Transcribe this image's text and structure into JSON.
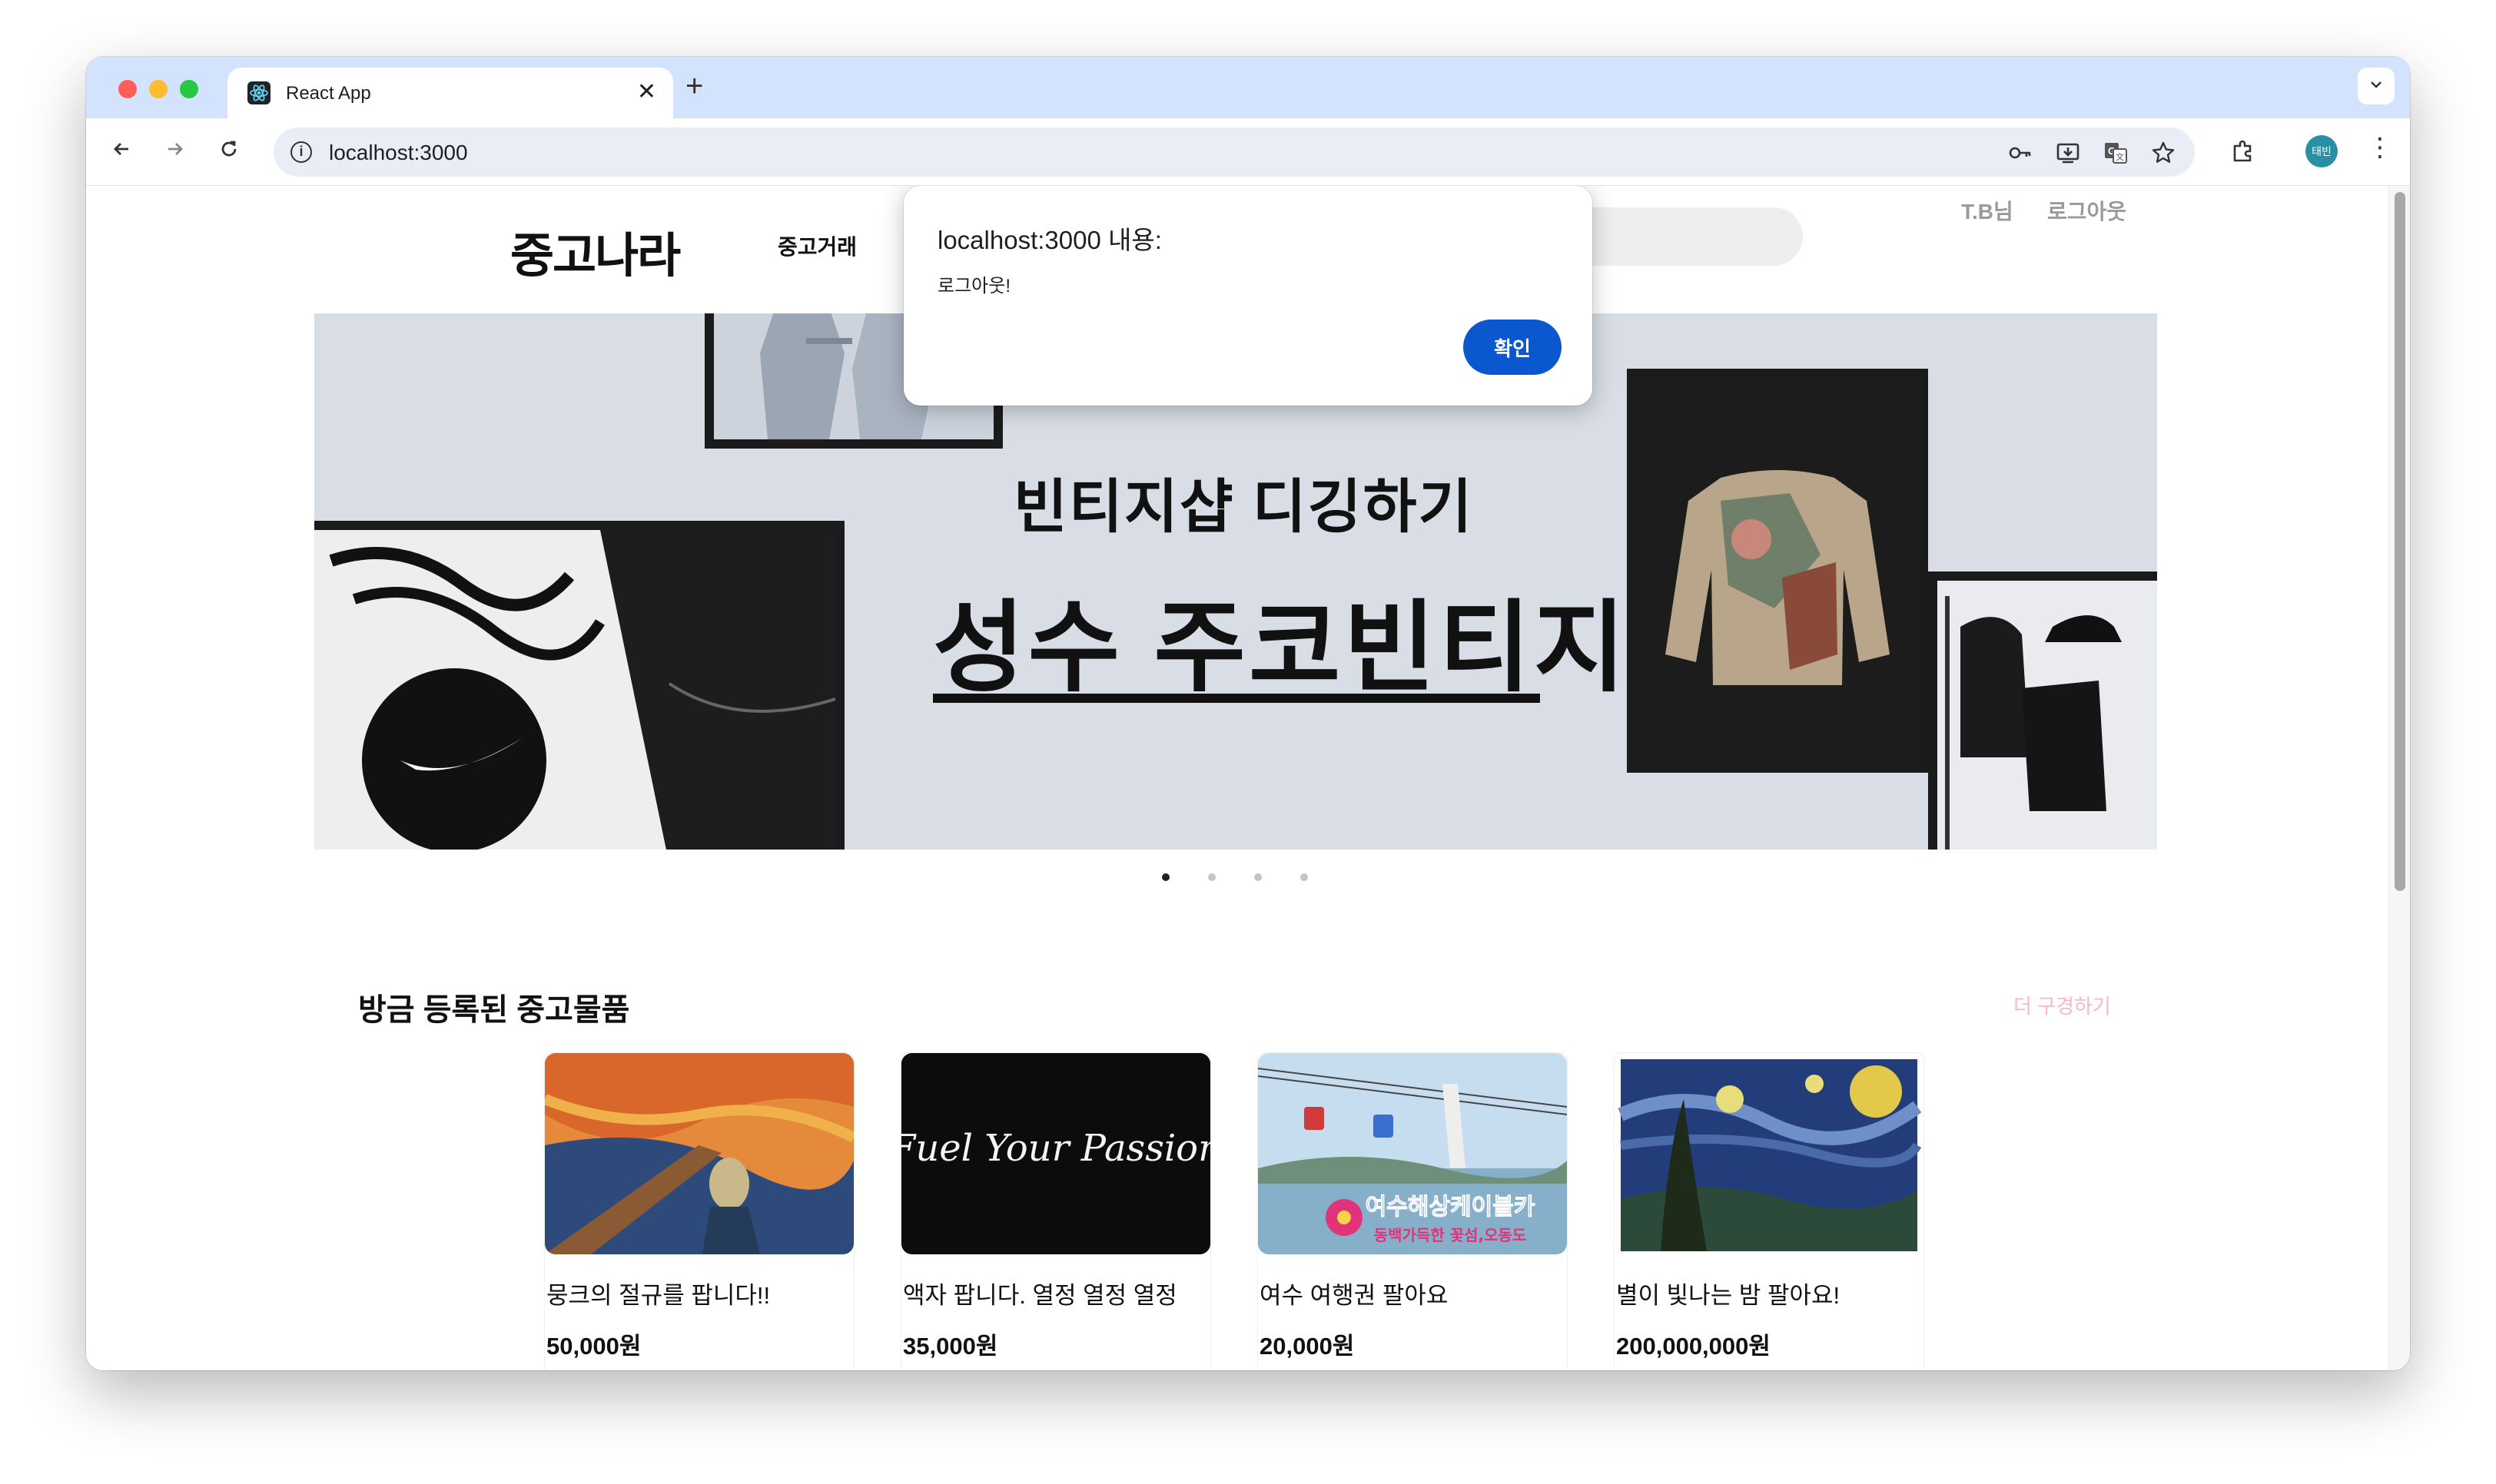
{
  "browser": {
    "tab_title": "React App",
    "tab_close": "✕",
    "new_tab": "+",
    "url": "localhost:3000",
    "profile_label": "태빈",
    "accent_color": "#0b57d0",
    "tabstrip_color": "#d3e3fd"
  },
  "site": {
    "logo": "중고나라",
    "nav_label": "중고거래",
    "user_name": "T.B님",
    "logout_label": "로그아웃"
  },
  "banner": {
    "line1": "빈티지샵 디깅하기",
    "line2": "성수 주코빈티지",
    "slide_count": 4,
    "active_slide": 1
  },
  "section": {
    "title": "방금 등록된 중고물품",
    "more_label": "더 구경하기",
    "more_color": "#f7b7c6"
  },
  "products": [
    {
      "title": "뭉크의 절규를 팝니다!!",
      "price": "50,000원"
    },
    {
      "title": "액자 팝니다. 열정 열정 열정",
      "price": "35,000원",
      "image_text": "Fuel Your Passion"
    },
    {
      "title": "여수 여행권 팔아요",
      "price": "20,000원",
      "image_text": "여수해상케이블카",
      "image_subtext": "동백가득한 꽃섬,오동도"
    },
    {
      "title": "별이 빛나는 밤 팔아요!",
      "price": "200,000,000원"
    }
  ],
  "dialog": {
    "title": "localhost:3000 내용:",
    "message": "로그아웃!",
    "ok_label": "확인"
  }
}
